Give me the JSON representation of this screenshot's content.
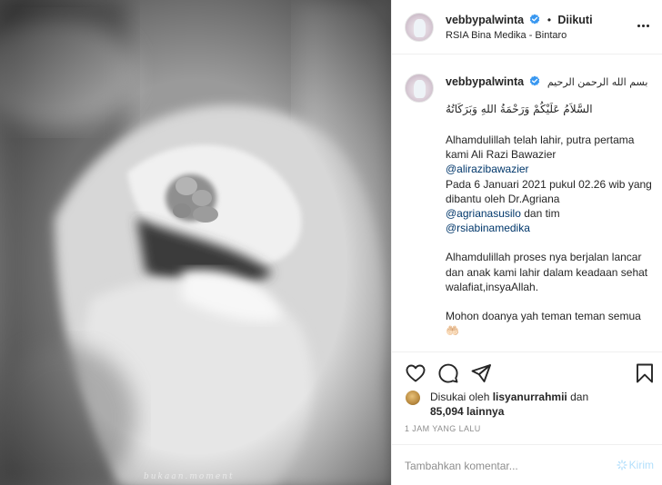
{
  "post": {
    "username": "vebbypalwinta",
    "follow_status": "Diikuti",
    "location": "RSIA Bina Medika - Bintaro",
    "watermark": "bukaan.moment"
  },
  "caption": {
    "bismillah": "بسم الله الرحمن الرحيم",
    "salam": "السَّلاَمُ عَلَيْكُمْ وَرَحْمَةُ اللهِ وَبَرَكَاتُهُ",
    "line1": "Alhamdulillah telah lahir, putra pertama kami Ali Razi Bawazier",
    "mention1": "@alirazibawazier",
    "line2": "Pada 6 Januari 2021 pukul 02.26 wib yang dibantu oleh Dr.Agriana",
    "mention2": "@agrianasusilo",
    "line2b": " dan tim",
    "mention3": "@rsiabinamedika",
    "para2": "Alhamdulillah proses nya berjalan lancar dan anak kami lahir dalam keadaan sehat walafiat,insyaAllah.",
    "para3": "Mohon doanya yah teman teman semua 🤲🏻"
  },
  "likes": {
    "prefix": "Disukai oleh",
    "liker": "lisyanurrahmii",
    "conj": "dan",
    "others": "85,094 lainnya"
  },
  "timestamp": "1 JAM YANG LALU",
  "comment": {
    "placeholder": "Tambahkan komentar...",
    "post_label": "Kirim"
  },
  "colors": {
    "verified": "#3897f0",
    "mention": "#00376b",
    "post_disabled": "#b2dffc",
    "muted": "#8e8e8e"
  },
  "icons": [
    "verified-badge-icon",
    "more-options-icon",
    "heart-icon",
    "comment-icon",
    "share-icon",
    "bookmark-icon",
    "emoji-icon"
  ]
}
